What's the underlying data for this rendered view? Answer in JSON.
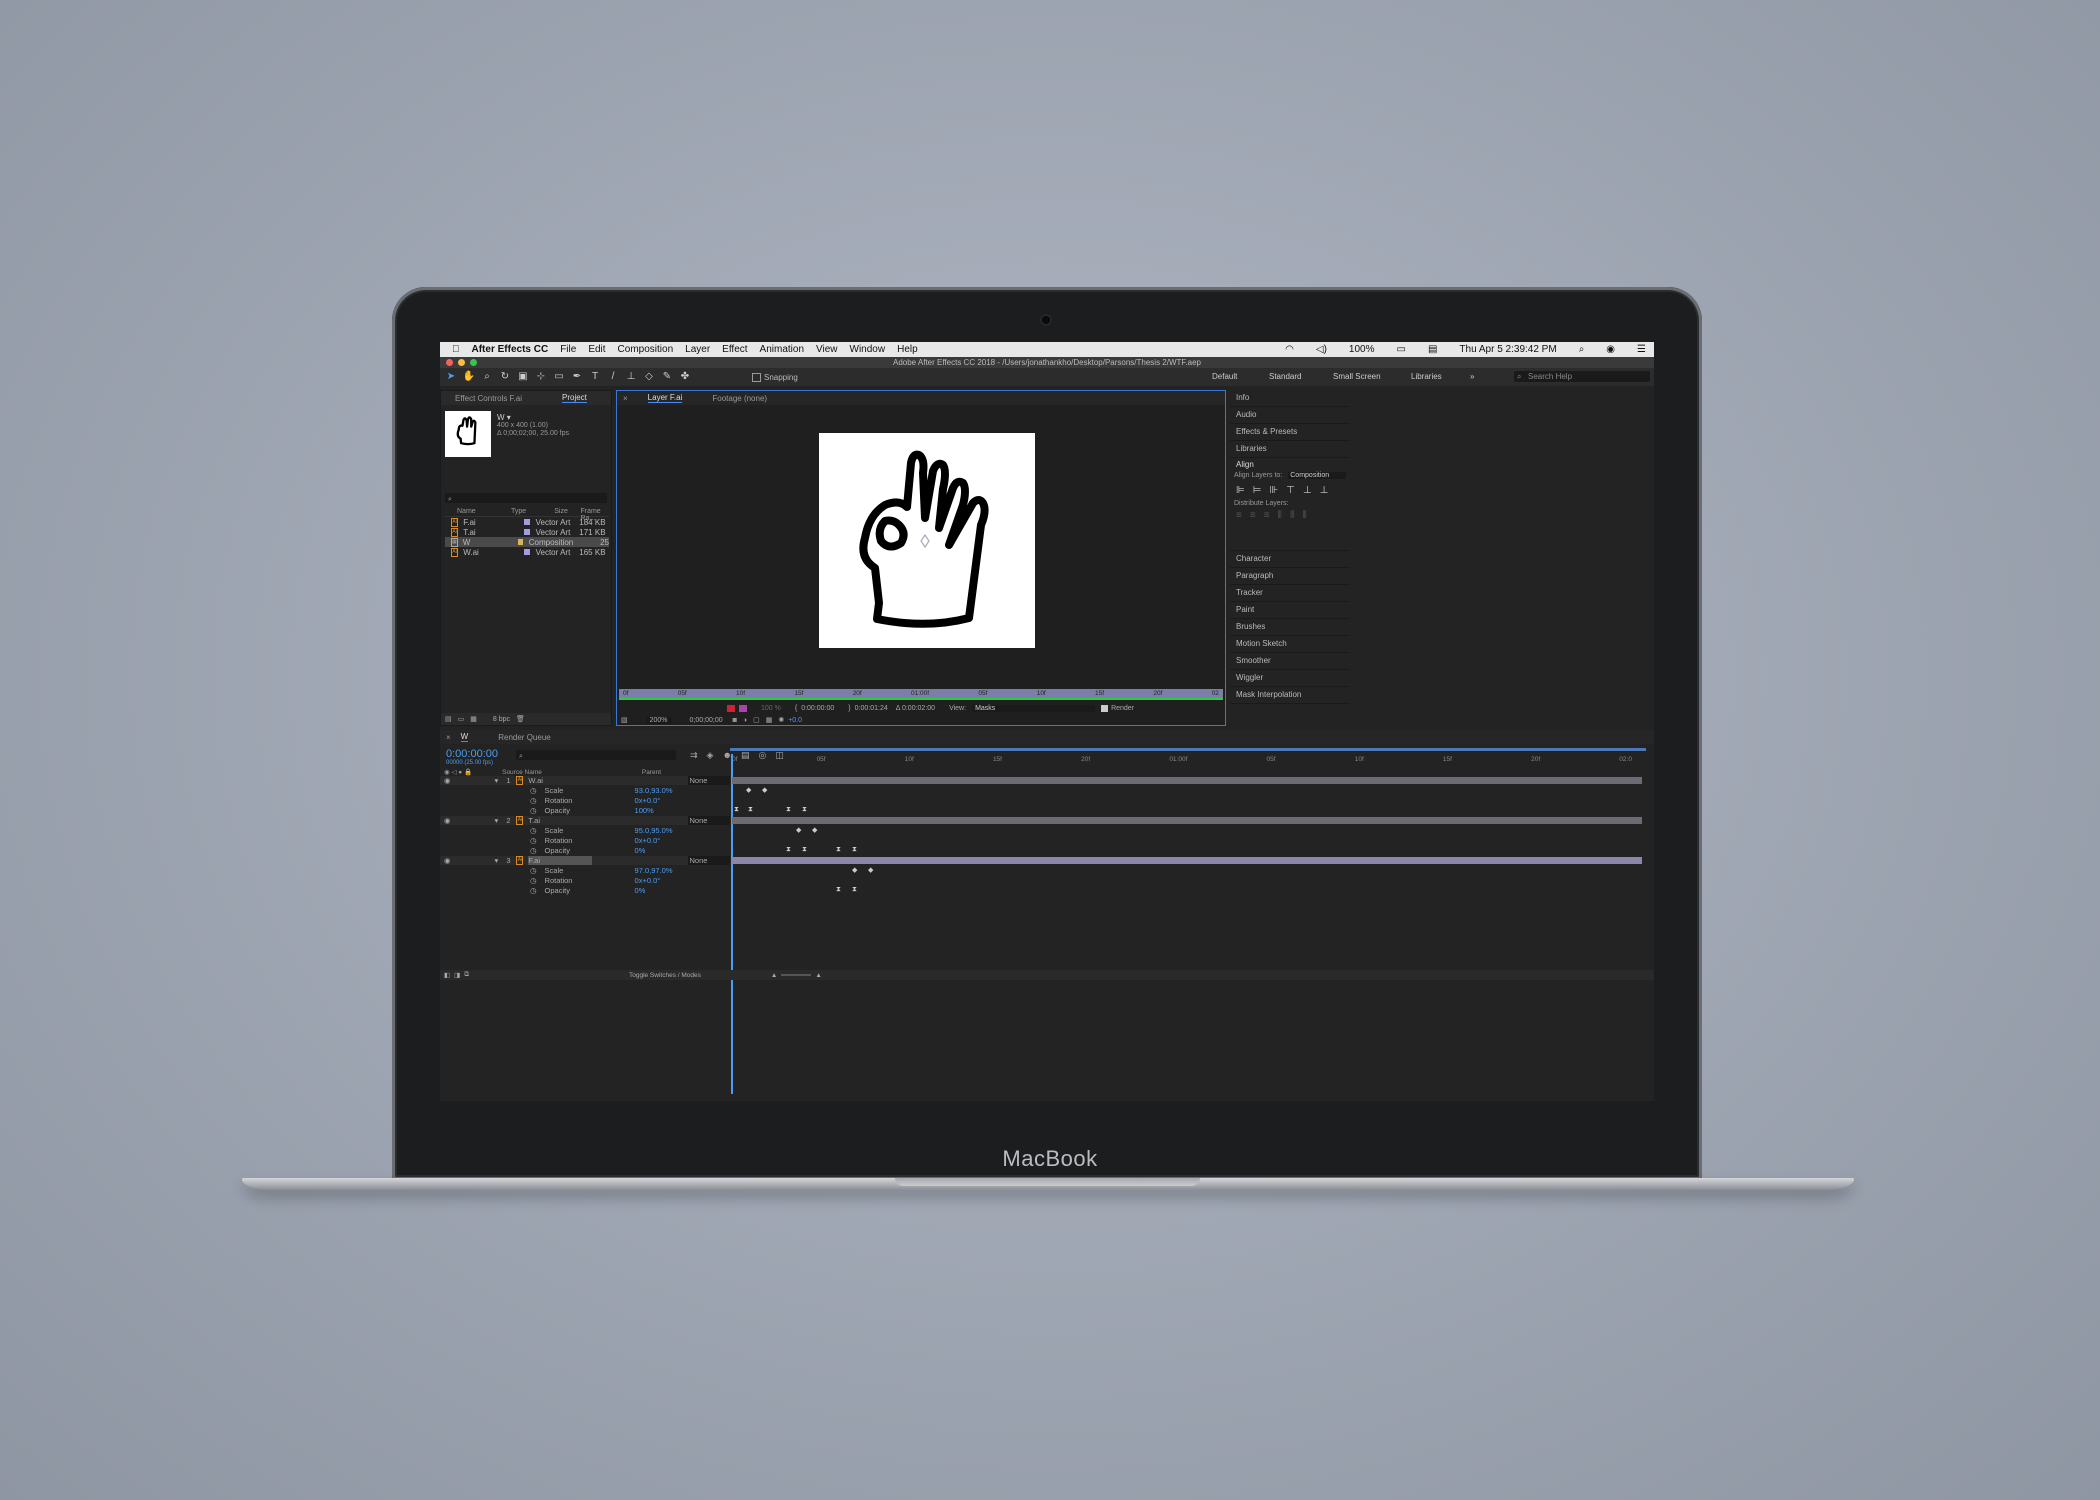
{
  "device": {
    "brand": "MacBook"
  },
  "menubar": {
    "app_name": "After Effects CC",
    "items": [
      "File",
      "Edit",
      "Composition",
      "Layer",
      "Effect",
      "Animation",
      "View",
      "Window",
      "Help"
    ],
    "battery": "100%",
    "clock": "Thu Apr 5  2:39:42 PM"
  },
  "window": {
    "title": "Adobe After Effects CC 2018 - /Users/jonathankho/Desktop/Parsons/Thesis 2/WTF.aep"
  },
  "toolbar": {
    "snapping_label": "Snapping",
    "workspaces": [
      "Default",
      "Standard",
      "Small Screen",
      "Libraries"
    ],
    "search_placeholder": "Search Help"
  },
  "project_panel": {
    "tabs": [
      "Effect Controls F.ai",
      "Project"
    ],
    "preview_name": "W ▾",
    "preview_size": "400 x 400 (1.00)",
    "preview_duration": "Δ 0;00;02;00, 25.00 fps",
    "columns": [
      "Name",
      "Type",
      "Size",
      "Frame Ra..."
    ],
    "items": [
      {
        "name": "F.ai",
        "type": "Vector Art",
        "size": "184 KB",
        "fps": ""
      },
      {
        "name": "T.ai",
        "type": "Vector Art",
        "size": "171 KB",
        "fps": ""
      },
      {
        "name": "W",
        "type": "Composition",
        "size": "",
        "fps": "25"
      },
      {
        "name": "W.ai",
        "type": "Vector Art",
        "size": "165 KB",
        "fps": ""
      }
    ],
    "bpc": "8 bpc"
  },
  "viewer": {
    "tabs": [
      "Layer F.ai",
      "Footage (none)"
    ],
    "ruler_labels": [
      "0f",
      "05f",
      "10f",
      "15f",
      "20f",
      "01:00f",
      "05f",
      "10f",
      "15f",
      "20f",
      "02"
    ],
    "in_time": "0:00:00:00",
    "out_time": "0:00:01:24",
    "duration": "Δ 0:00:02:00",
    "view_label": "View:",
    "view_value": "Masks",
    "render_label": "Render",
    "zoom": "200%",
    "current_time": "0;00;00;00",
    "exposure": "+0.0",
    "percent": "100 %"
  },
  "right_panel": {
    "items_top": [
      "Info",
      "Audio",
      "Effects & Presets",
      "Libraries"
    ],
    "align_title": "Align",
    "align_to_label": "Align Layers to:",
    "align_to_value": "Composition",
    "distribute_label": "Distribute Layers:",
    "items_bottom": [
      "Character",
      "Paragraph",
      "Tracker",
      "Paint",
      "Brushes",
      "Motion Sketch",
      "Smoother",
      "Wiggler",
      "Mask Interpolation"
    ]
  },
  "timeline": {
    "tabs": [
      "W",
      "Render Queue"
    ],
    "current_time": "0:00:00:00",
    "current_frame": "00000 (25.00 fps)",
    "col_source": "Source Name",
    "col_parent": "Parent",
    "ruler_labels": [
      "0f",
      "05f",
      "10f",
      "15f",
      "20f",
      "01:00f",
      "05f",
      "10f",
      "15f",
      "20f",
      "02:0"
    ],
    "layers": [
      {
        "num": "1",
        "name": "W.ai",
        "parent": "None",
        "props": [
          {
            "name": "Scale",
            "value": "93.0,93.0%"
          },
          {
            "name": "Rotation",
            "value": "0x+0.0°"
          },
          {
            "name": "Opacity",
            "value": "100%"
          }
        ]
      },
      {
        "num": "2",
        "name": "T.ai",
        "parent": "None",
        "props": [
          {
            "name": "Scale",
            "value": "95.0,95.0%"
          },
          {
            "name": "Rotation",
            "value": "0x+0.0°"
          },
          {
            "name": "Opacity",
            "value": "0%"
          }
        ]
      },
      {
        "num": "3",
        "name": "F.ai",
        "parent": "None",
        "props": [
          {
            "name": "Scale",
            "value": "97.0,97.0%"
          },
          {
            "name": "Rotation",
            "value": "0x+0.0°"
          },
          {
            "name": "Opacity",
            "value": "0%"
          }
        ]
      }
    ],
    "toggle_label": "Toggle Switches / Modes"
  }
}
